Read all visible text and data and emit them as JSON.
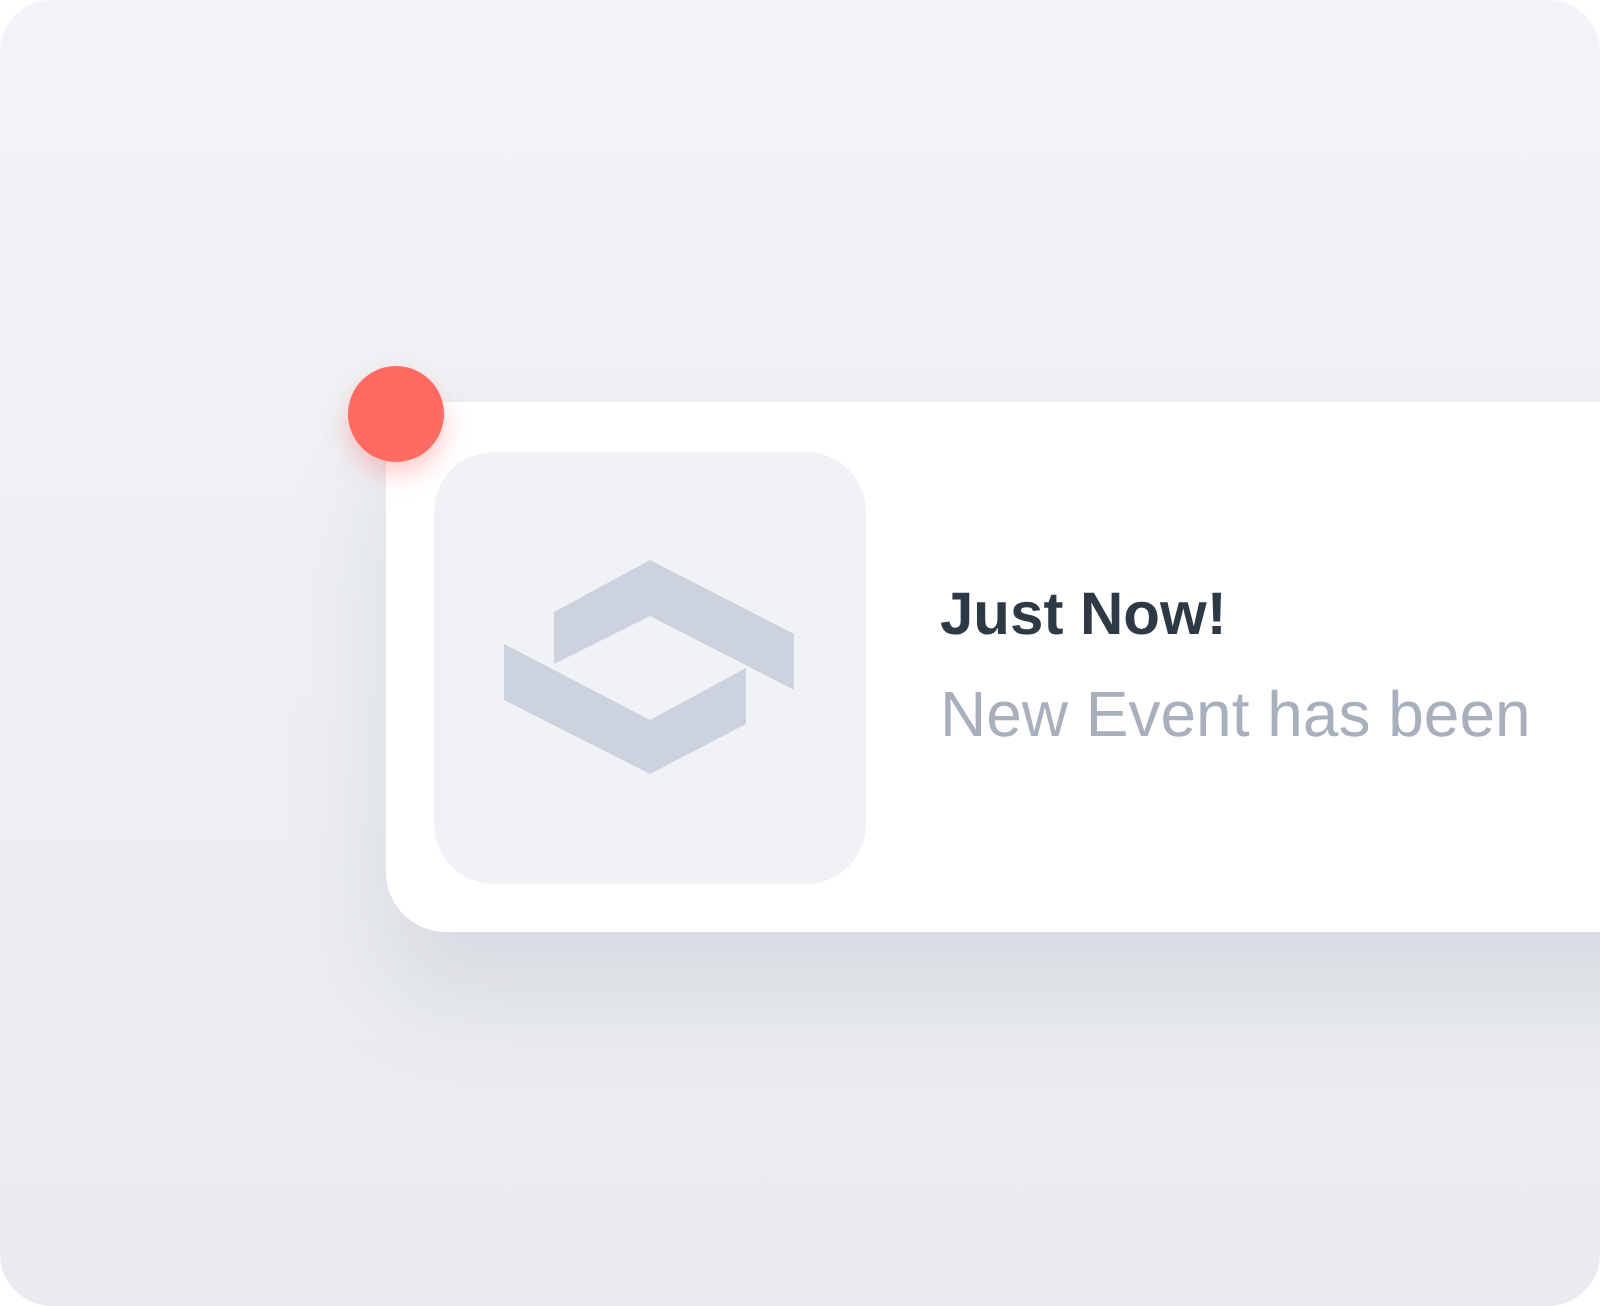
{
  "notification": {
    "unread": true,
    "title": "Just Now!",
    "message": "New Event has been"
  }
}
